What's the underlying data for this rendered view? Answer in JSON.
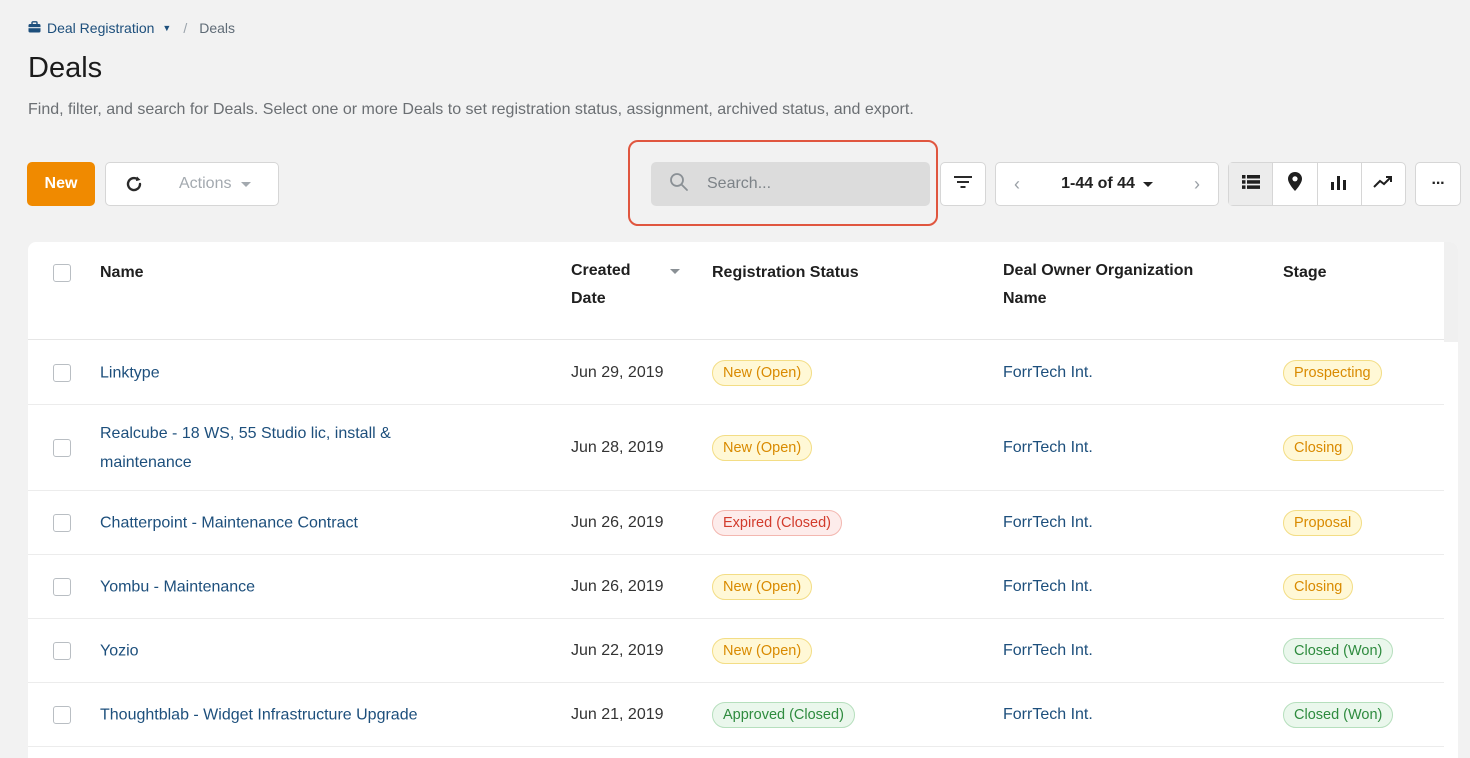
{
  "breadcrumb": {
    "parent": "Deal Registration",
    "current": "Deals",
    "separator": "/"
  },
  "page": {
    "title": "Deals",
    "description": "Find, filter, and search for Deals. Select one or more Deals to set registration status, assignment, archived status, and export."
  },
  "toolbar": {
    "new_label": "New",
    "actions_label": "Actions",
    "search_placeholder": "Search...",
    "pager_label": "1-44 of 44",
    "prev": "‹",
    "next": "›",
    "more": "···"
  },
  "colors": {
    "accent": "#f08a00",
    "link": "#1d4f7c",
    "highlight": "#e0563f"
  },
  "table": {
    "headers": {
      "name": "Name",
      "created_line1": "Created",
      "created_line2": "Date",
      "registration": "Registration Status",
      "org_line1": "Deal Owner Organization",
      "org_line2": "Name",
      "stage": "Stage"
    },
    "rows": [
      {
        "name": "Linktype",
        "date": "Jun 29, 2019",
        "reg": "New (Open)",
        "org": "ForrTech Int.",
        "stage": "Prospecting"
      },
      {
        "name": "Realcube - 18 WS, 55 Studio lic, install & maintenance",
        "date": "Jun 28, 2019",
        "reg": "New (Open)",
        "org": "ForrTech Int.",
        "stage": "Closing"
      },
      {
        "name": "Chatterpoint - Maintenance Contract",
        "date": "Jun 26, 2019",
        "reg": "Expired (Closed)",
        "org": "ForrTech Int.",
        "stage": "Proposal"
      },
      {
        "name": "Yombu - Maintenance",
        "date": "Jun 26, 2019",
        "reg": "New (Open)",
        "org": "ForrTech Int.",
        "stage": "Closing"
      },
      {
        "name": "Yozio",
        "date": "Jun 22, 2019",
        "reg": "New (Open)",
        "org": "ForrTech Int.",
        "stage": "Closed (Won)"
      },
      {
        "name": "Thoughtblab - Widget Infrastructure Upgrade",
        "date": "Jun 21, 2019",
        "reg": "Approved (Closed)",
        "org": "ForrTech Int.",
        "stage": "Closed (Won)"
      }
    ]
  }
}
